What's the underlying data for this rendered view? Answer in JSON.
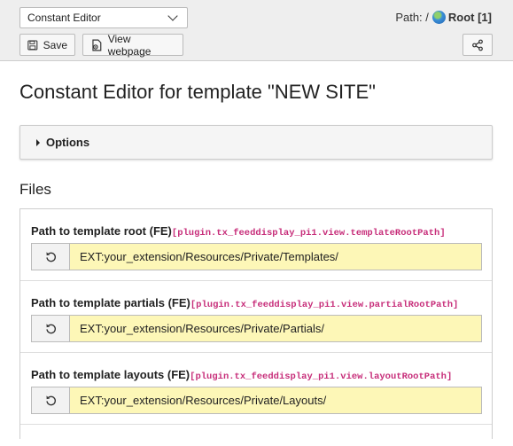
{
  "toolbar": {
    "module_select": "Constant Editor",
    "path_label": "Path: /",
    "root_label": "Root [1]",
    "save_label": "Save",
    "view_label": "View webpage"
  },
  "page": {
    "title": "Constant Editor for template \"NEW SITE\"",
    "options_label": "Options",
    "section_title": "Files"
  },
  "rows": [
    {
      "label": "Path to template root (FE)",
      "key": "[plugin.tx_feeddisplay_pi1.view.templateRootPath]",
      "value": "EXT:your_extension/Resources/Private/Templates/"
    },
    {
      "label": "Path to template partials (FE)",
      "key": "[plugin.tx_feeddisplay_pi1.view.partialRootPath]",
      "value": "EXT:your_extension/Resources/Private/Partials/"
    },
    {
      "label": "Path to template layouts (FE)",
      "key": "[plugin.tx_feeddisplay_pi1.view.layoutRootPath]",
      "value": "EXT:your_extension/Resources/Private/Layouts/"
    }
  ],
  "colors": {
    "key_text": "#c72e7a",
    "field_background": "#fdf7b7"
  },
  "icons": [
    "chevron-down-icon",
    "globe-icon",
    "save-icon",
    "view-icon",
    "share-icon",
    "reset-icon",
    "caret-right-icon"
  ]
}
